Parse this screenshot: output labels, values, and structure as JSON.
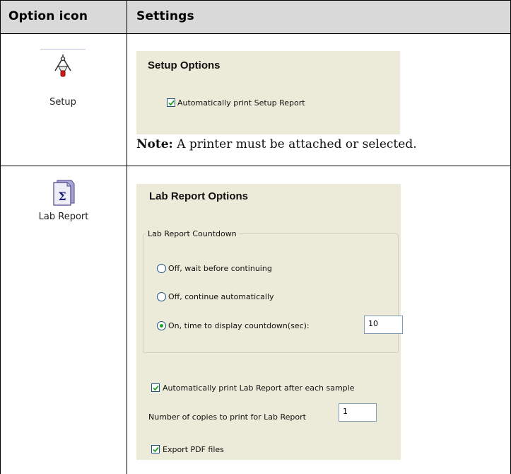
{
  "header": {
    "col1": "Option icon",
    "col2": "Settings"
  },
  "rows": [
    {
      "icon_name": "setup-icon",
      "icon_label": "Setup",
      "panel_title": "Setup Options",
      "checkbox_label": "Automatically print Setup Report",
      "checkbox_checked": true,
      "note_label": "Note:",
      "note_text": "A printer must be attached or selected."
    },
    {
      "icon_name": "lab-report-icon",
      "icon_label": "Lab Report",
      "panel_title": "Lab Report Options",
      "group_title": "Lab Report Countdown",
      "radio_options": [
        "Off, wait before continuing",
        "Off, continue automatically",
        "On, time to display countdown(sec):"
      ],
      "selected_radio": 2,
      "countdown_value": "10",
      "print_after_sample_label": "Automatically print Lab Report after each sample",
      "print_after_sample_checked": true,
      "copies_label": "Number of copies to print for Lab Report",
      "copies_value": "1",
      "export_pdf_label": "Export PDF files",
      "export_pdf_checked": true
    }
  ],
  "colors": {
    "header_bg": "#d9d9d9",
    "panel_bg": "#ecebd9",
    "check_green": "#21a121",
    "control_border": "#1c5180"
  }
}
